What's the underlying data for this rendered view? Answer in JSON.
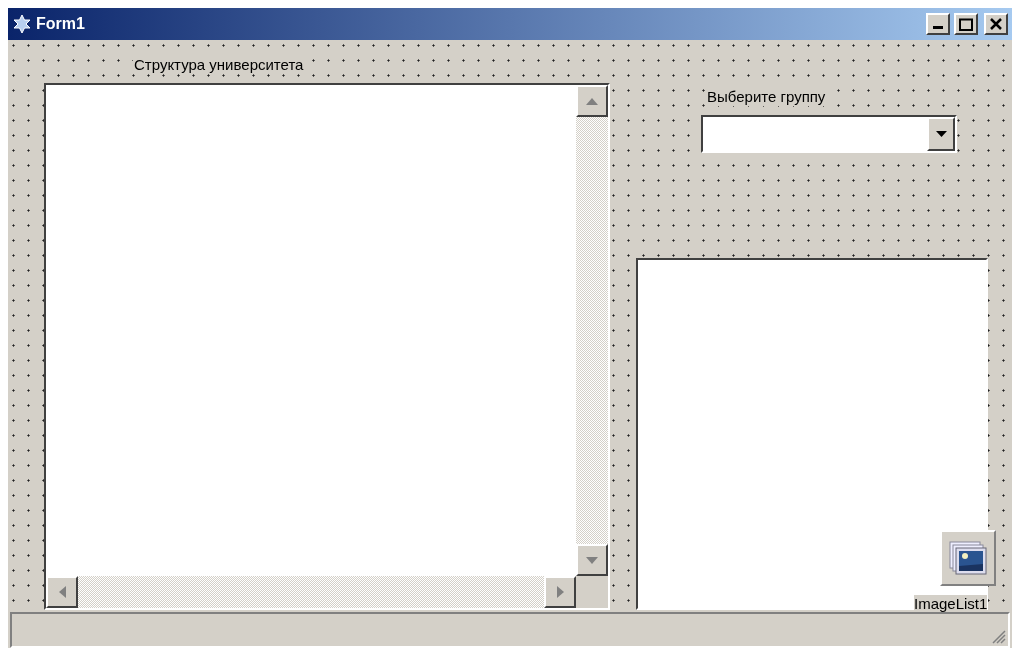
{
  "window": {
    "title": "Form1"
  },
  "tree_label": "Структура университета",
  "group_label": "Выберите группу",
  "components": [
    {
      "kind": "imagelist",
      "caption": "ImageList1"
    }
  ]
}
